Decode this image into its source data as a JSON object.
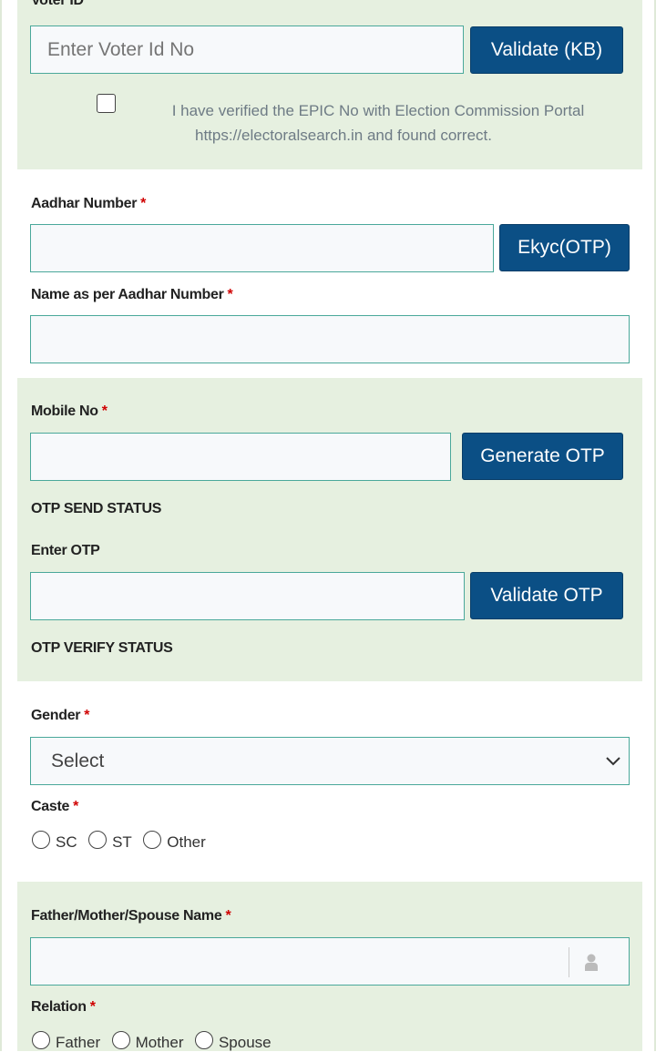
{
  "voter": {
    "label": "Voter ID",
    "required": "*",
    "placeholder": "Enter Voter Id No",
    "validate_label": "Validate (KB)",
    "verify_text_1": "I have verified the EPIC No with Election Commission Portal",
    "verify_text_2": "https://electoralsearch.in and found correct."
  },
  "aadhar": {
    "label": "Aadhar Number",
    "required": "*",
    "ekyc_label": "Ekyc(OTP)",
    "name_label": "Name as per Aadhar Number"
  },
  "mobile": {
    "label": "Mobile No",
    "required": "*",
    "generate_label": "Generate OTP",
    "send_status": "OTP SEND STATUS",
    "enter_otp_label": "Enter OTP",
    "validate_label": "Validate OTP",
    "verify_status": "OTP VERIFY STATUS"
  },
  "gender": {
    "label": "Gender",
    "required": "*",
    "selected": "Select"
  },
  "caste": {
    "label": "Caste",
    "required": "*",
    "options": [
      "SC",
      "ST",
      "Other"
    ]
  },
  "guardian": {
    "label": "Father/Mother/Spouse Name",
    "required": "*",
    "icon": "user-icon"
  },
  "relation": {
    "label": "Relation",
    "required": "*",
    "options": [
      "Father",
      "Mother",
      "Spouse"
    ]
  },
  "colors": {
    "button": "#0b4f85",
    "panel": "#e6f0e0",
    "required": "#d00000",
    "input_border": "#4aa89a"
  }
}
